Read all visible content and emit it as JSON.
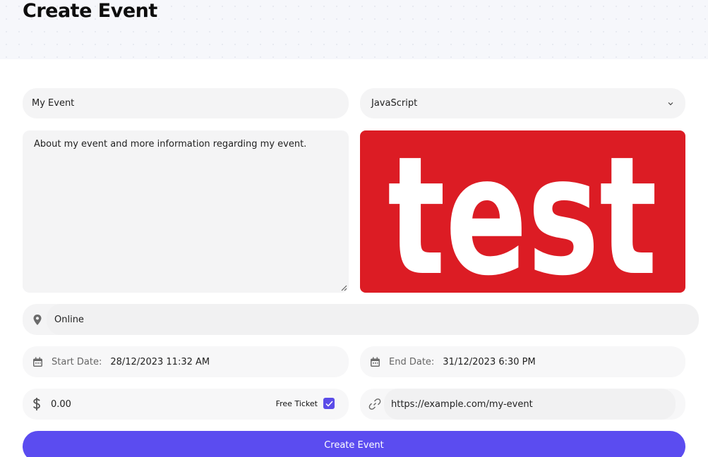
{
  "page": {
    "title": "Create Event"
  },
  "form": {
    "event_name": "My Event",
    "category": {
      "selected": "JavaScript",
      "icon": "chevron-down-icon"
    },
    "description": "About my event and more information regarding my event.",
    "image": {
      "word": "test",
      "background": "#dc1c24"
    },
    "location": {
      "value": "Online",
      "icon": "location-pin-icon"
    },
    "start_date": {
      "label": "Start Date:",
      "value": "28/12/2023 11:32 AM",
      "icon": "calendar-icon"
    },
    "end_date": {
      "label": "End Date:",
      "value": "31/12/2023 6:30 PM",
      "icon": "calendar-icon"
    },
    "price": {
      "value": "0.00",
      "icon": "dollar-icon"
    },
    "free_ticket": {
      "label": "Free Ticket",
      "checked": true
    },
    "link": {
      "value": "https://example.com/my-event",
      "icon": "link-icon"
    },
    "submit_label": "Create Event"
  },
  "colors": {
    "accent": "#5b4cf0",
    "field_bg": "#f4f4f5"
  }
}
